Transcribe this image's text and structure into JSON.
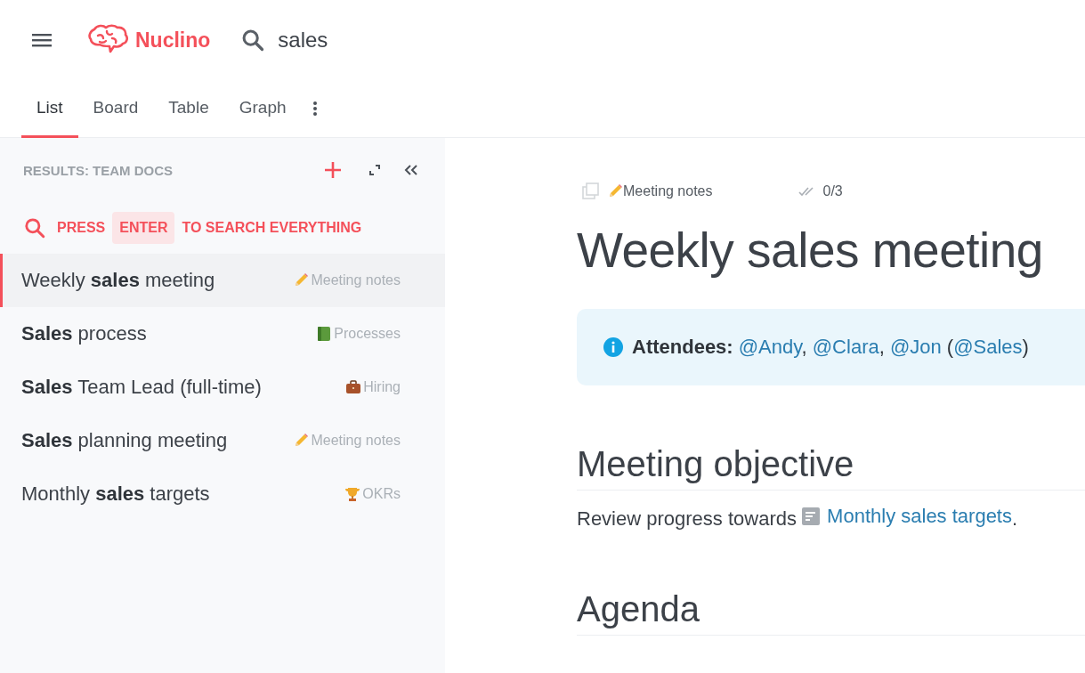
{
  "header": {
    "logo": "Nuclino",
    "search": "sales"
  },
  "tabs": [
    {
      "label": "List",
      "selected": true
    },
    {
      "label": "Board",
      "selected": false
    },
    {
      "label": "Table",
      "selected": false
    },
    {
      "label": "Graph",
      "selected": false
    }
  ],
  "sidebar": {
    "heading": "RESULTS: TEAM DOCS",
    "hint": {
      "before": "PRESS",
      "key": "ENTER",
      "after": "TO SEARCH EVERYTHING"
    },
    "results": [
      {
        "title": "Weekly **sales** meeting",
        "category": "Meeting notes",
        "kind": "pencil",
        "selected": true
      },
      {
        "title": "**Sales** process",
        "category": "Processes",
        "kind": "book",
        "selected": false
      },
      {
        "title": "**Sales** Team Lead (full-time)",
        "category": "Hiring",
        "kind": "briefcase",
        "selected": false
      },
      {
        "title": "**Sales** planning meeting",
        "category": "Meeting notes",
        "kind": "pencil",
        "selected": false
      },
      {
        "title": "Monthly **sales** targets",
        "category": "OKRs",
        "kind": "trophy",
        "selected": false
      }
    ]
  },
  "document": {
    "category": "Meeting notes",
    "tasks": "0/3",
    "title": "Weekly sales meeting",
    "callout": [
      {
        "kind": "label",
        "text": "Attendees:"
      },
      {
        "kind": "link",
        "text": "@Andy"
      },
      {
        "kind": "text",
        "text": ", "
      },
      {
        "kind": "link",
        "text": "@Clara"
      },
      {
        "kind": "text",
        "text": ", "
      },
      {
        "kind": "link",
        "text": "@Jon"
      },
      {
        "kind": "text",
        "text": " ("
      },
      {
        "kind": "link",
        "text": "@Sales"
      },
      {
        "kind": "text",
        "text": ")"
      }
    ],
    "sections": [
      {
        "heading": "Meeting objective",
        "parts": [
          {
            "kind": "text",
            "text": "Review progress towards "
          },
          {
            "kind": "doclink",
            "text": "Monthly sales targets"
          },
          {
            "kind": "text",
            "text": "."
          }
        ]
      },
      {
        "heading": "Agenda"
      }
    ]
  }
}
